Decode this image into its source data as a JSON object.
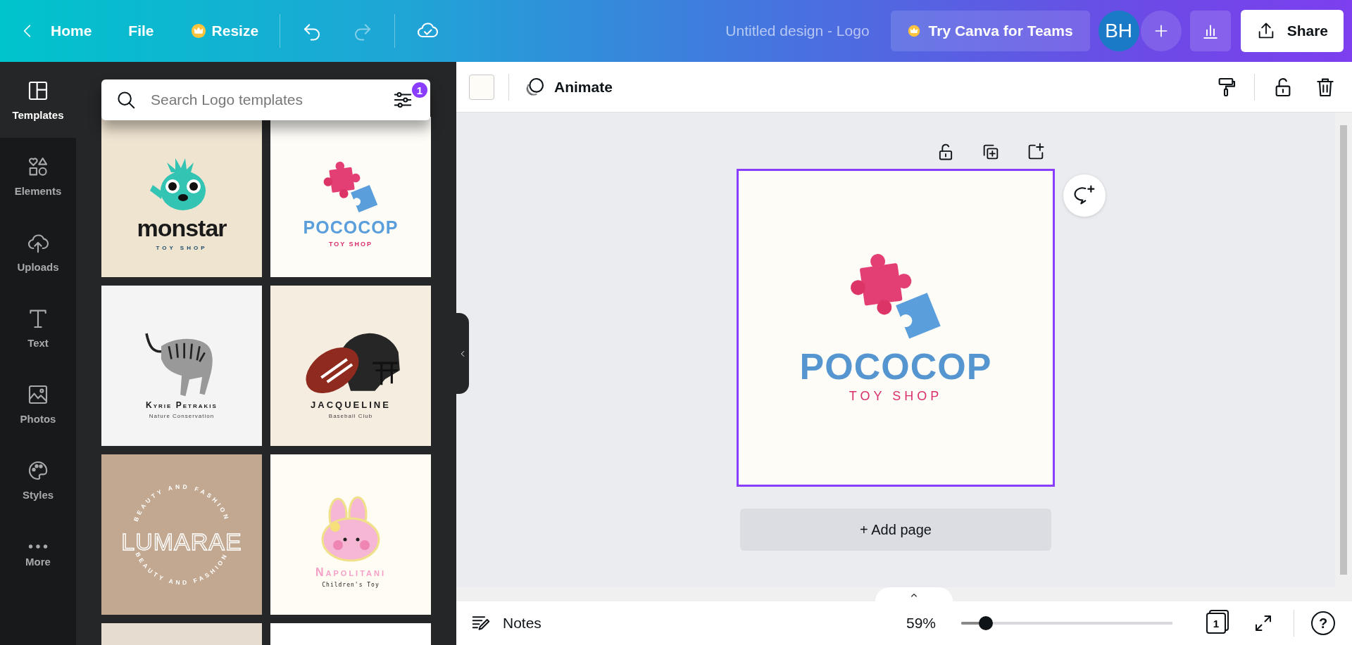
{
  "top_bar": {
    "back": "Home",
    "menus": [
      {
        "label": "File",
        "kind": "plain"
      },
      {
        "label": "Resize",
        "kind": "premium"
      }
    ],
    "undo": {
      "disabled": false
    },
    "redo": {
      "disabled": true
    },
    "title": "Untitled design - Logo",
    "teams_button": "Try Canva for Teams",
    "avatar": "BH",
    "share": "Share"
  },
  "sidebar": {
    "items": [
      {
        "label": "Templates",
        "selected": true
      },
      {
        "label": "Elements",
        "selected": false
      },
      {
        "label": "Uploads",
        "selected": false
      },
      {
        "label": "Text",
        "selected": false
      },
      {
        "label": "Photos",
        "selected": false
      },
      {
        "label": "Styles",
        "selected": false
      },
      {
        "label": "More",
        "selected": false
      }
    ]
  },
  "templates_panel": {
    "search": {
      "placeholder": "Search Logo templates"
    },
    "filter_count": "1",
    "templates": [
      {
        "kind": "monster",
        "title": "monstar",
        "subtitle": "TOY SHOP"
      },
      {
        "kind": "puzzle",
        "title": "POCOCOP",
        "subtitle": "TOY SHOP"
      },
      {
        "kind": "tiger",
        "title": "Kyrie Petrakis",
        "subtitle": "Nature Conservation"
      },
      {
        "kind": "helmet",
        "title": "JACQUELINE",
        "subtitle": "Baseball Club"
      },
      {
        "kind": "ring",
        "title": "LUMARAE",
        "arcs": [
          "BEAUTY AND FASHION",
          "BEAUTY AND FASHION"
        ]
      },
      {
        "kind": "bunny",
        "title": "Napolitani",
        "subtitle": "Children's Toy"
      },
      {
        "kind": "plain"
      },
      {
        "kind": "blank"
      }
    ]
  },
  "editor": {
    "toolbar": {
      "animate": "Animate"
    },
    "page": {
      "selected": true,
      "title": "POCOCOP",
      "subtitle": "TOY SHOP"
    },
    "add_page": "+ Add page"
  },
  "bottom_bar": {
    "notes": "Notes",
    "zoom": "59%",
    "zoom_slider": {
      "level": 0.09
    },
    "page_count": "1",
    "help": "?"
  }
}
